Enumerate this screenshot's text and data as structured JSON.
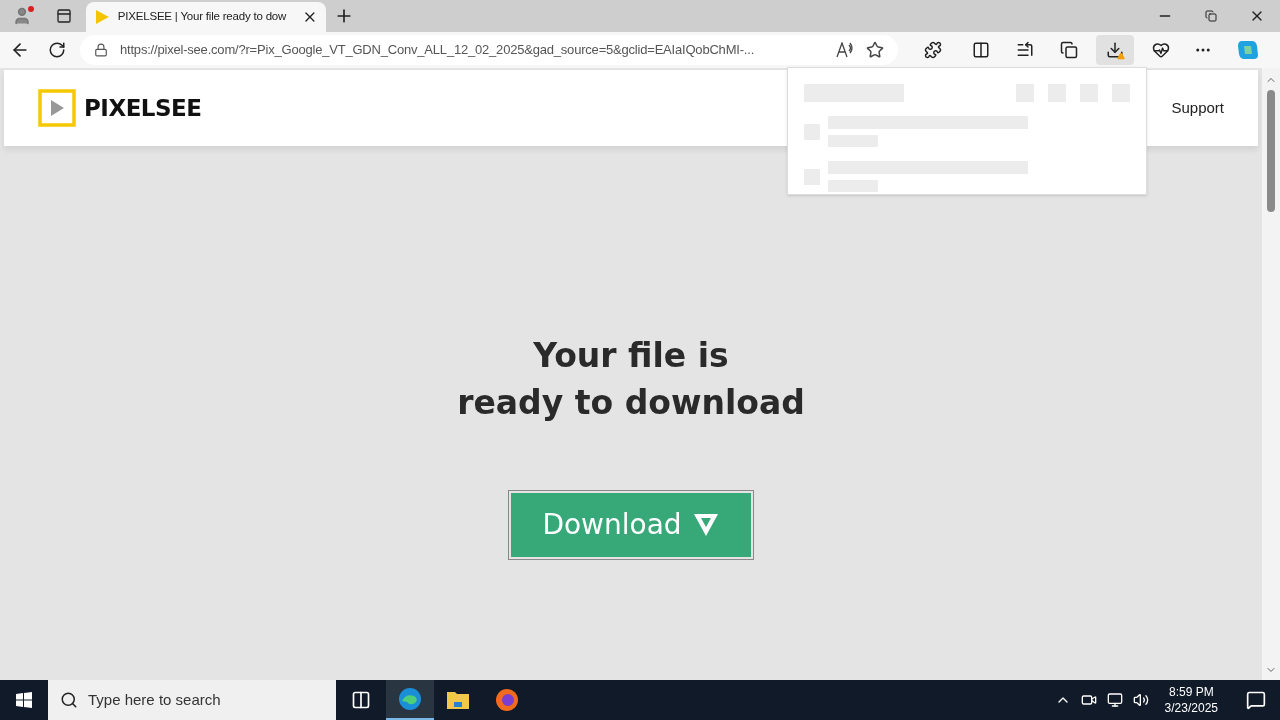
{
  "browser": {
    "tab": {
      "title": "PIXELSEE | Your file ready to dow",
      "selected": true
    },
    "url": "https://pixel-see.com/?r=Pix_Google_VT_GDN_Conv_ALL_12_02_2025&gad_source=5&gclid=EAIaIQobChMI-...",
    "downloads_panel": {
      "expanded": true
    }
  },
  "page": {
    "logo": "PIXELSEE",
    "nav": [
      "Support"
    ],
    "heading_lines": [
      "Your file is",
      "ready to download"
    ],
    "download_button": "Download"
  },
  "taskbar": {
    "search": {
      "placeholder": "Type here to search"
    },
    "time": "8:59 PM",
    "date": "3/23/2025"
  }
}
